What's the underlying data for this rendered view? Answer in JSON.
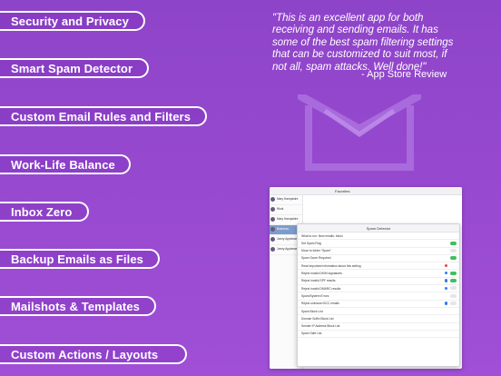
{
  "features": [
    "Security and Privacy",
    "Smart Spam Detector",
    "Custom Email Rules and Filters",
    "Work-Life Balance",
    "Inbox Zero",
    "Backup Emails as Files",
    "Mailshots & Templates",
    "Custom Actions / Layouts"
  ],
  "quote": {
    "text": "\"This is an excellent app for both receiving and sending emails. It has some of the best spam filtering settings that can be customized to suit most, if not all, spam attacks. Well done!\"",
    "source": "- App Store Review"
  },
  "colors": {
    "background_top": "#8e44c9",
    "background_bottom": "#a04fd6",
    "pill_border": "#ffffff"
  },
  "screenshot": {
    "window_title": "Favorites",
    "dialog_title": "Spam Detector",
    "messages": [
      "Mary Hampshire",
      "Work",
      "Mary Hampshire",
      "Business",
      "Jonny Applessed",
      "Jonny Applessed"
    ],
    "settings": [
      "What to run: New emails: Inbox",
      "Set Spam Flag",
      "Move to folder \"Spam\"",
      "Spam Score Required",
      "Read important information about this setting",
      "Reject invalid DKIM signatures",
      "Reject invalid SPF results",
      "Reject invalid DMARC results",
      "Spam/System Errors",
      "Reject unknown BCC emails",
      "Spam Block List",
      "Domain Suffix Block List",
      "Sender IP Address Block List",
      "Spam Safe List"
    ]
  }
}
